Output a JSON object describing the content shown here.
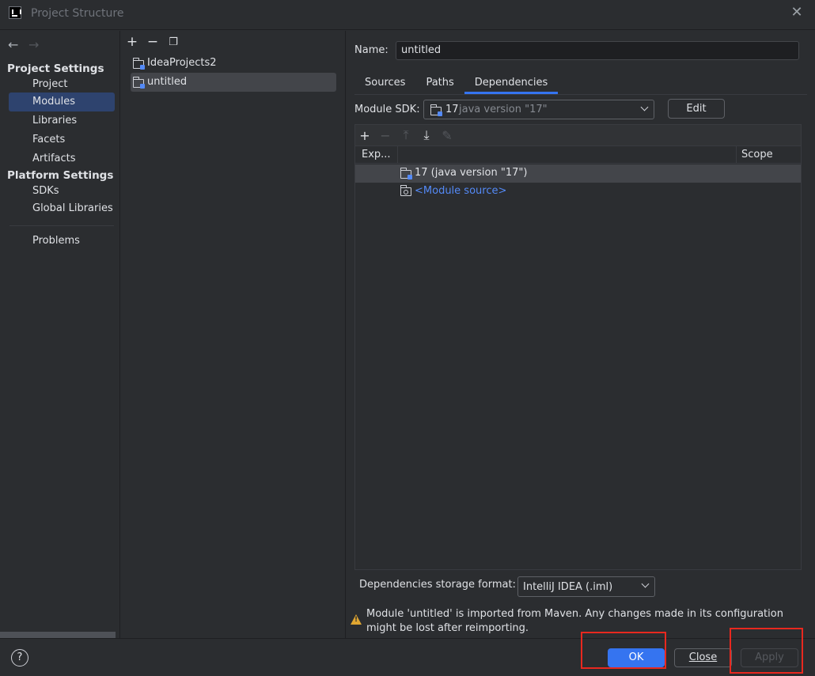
{
  "window": {
    "title": "Project Structure"
  },
  "nav": {
    "project_settings_header": "Project Settings",
    "project_items": [
      {
        "label": "Project",
        "selected": false
      },
      {
        "label": "Modules",
        "selected": true
      },
      {
        "label": "Libraries",
        "selected": false
      },
      {
        "label": "Facets",
        "selected": false
      },
      {
        "label": "Artifacts",
        "selected": false
      }
    ],
    "platform_settings_header": "Platform Settings",
    "platform_items": [
      {
        "label": "SDKs"
      },
      {
        "label": "Global Libraries"
      }
    ],
    "problems_label": "Problems"
  },
  "modules": {
    "toolbar_icons": [
      "add-icon",
      "remove-icon",
      "copy-icon"
    ],
    "items": [
      {
        "label": "IdeaProjects2",
        "selected": false
      },
      {
        "label": "untitled",
        "selected": true
      }
    ]
  },
  "detail": {
    "name_label": "Name:",
    "name_value": "untitled",
    "tabs": [
      "Sources",
      "Paths",
      "Dependencies"
    ],
    "active_tab": "Dependencies",
    "sdk_label": "Module SDK:",
    "sdk_value": "17",
    "sdk_detail": "java version \"17\"",
    "edit_label": "Edit",
    "dep_toolbar_icons": [
      "add-icon",
      "remove-icon",
      "move-up-icon",
      "move-down-icon",
      "edit-icon"
    ],
    "columns": {
      "export": "Exp...",
      "scope": "Scope"
    },
    "rows": [
      {
        "label": "17 (java version \"17\")",
        "selected": true
      },
      {
        "label": "<Module source>",
        "selected": false
      }
    ],
    "format_label": "Dependencies storage format:",
    "format_value": "IntelliJ IDEA (.iml)",
    "warning": "Module 'untitled' is imported from Maven. Any changes made in its configuration might be lost after reimporting."
  },
  "buttons": {
    "help": "?",
    "ok": "OK",
    "close": "Close",
    "apply": "Apply"
  },
  "colors": {
    "accent": "#3574f0",
    "link": "#548af7",
    "warning": "#e0a631",
    "highlight": "#e8281f"
  }
}
